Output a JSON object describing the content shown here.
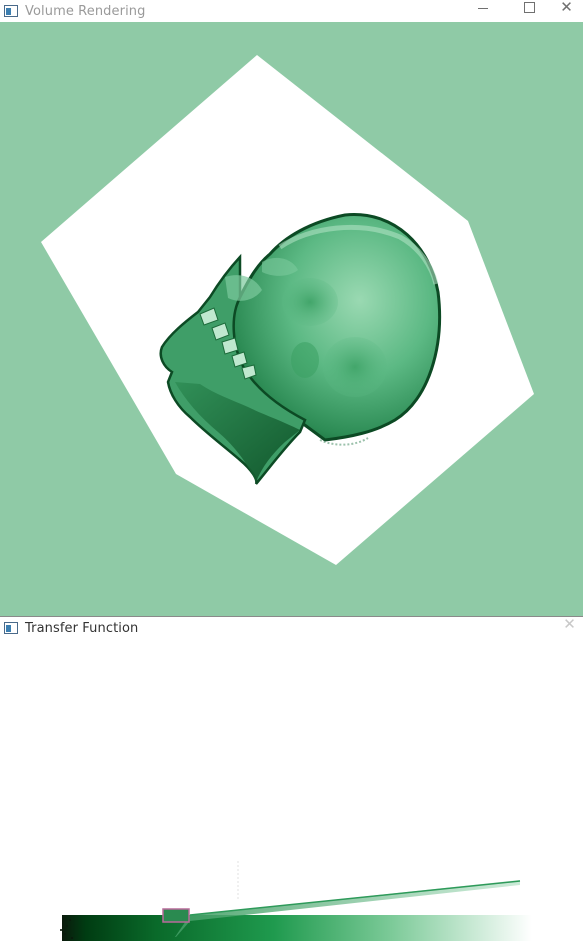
{
  "volume_window": {
    "title": "Volume Rendering",
    "icon": "app-window-icon",
    "controls": {
      "minimize": "minimize-icon",
      "maximize": "maximize-icon",
      "close": "close-icon"
    },
    "colors": {
      "background": "#8fcaa6",
      "bounding_box": "#ffffff",
      "skull_dark": "#0e5a2c",
      "skull_mid": "#3da66a",
      "skull_light": "#8ed5a8"
    }
  },
  "transfer_window": {
    "title": "Transfer Function",
    "icon": "app-window-icon",
    "controls": {
      "close": "close-icon"
    },
    "colors": {
      "gradient_dark": "#003c12",
      "gradient_mid": "#1a9a4a",
      "gradient_light": "#ffffff",
      "curve": "#2e9a5a",
      "control_point_border": "#b86a9a",
      "control_point_fill": "#2a8a50"
    }
  }
}
